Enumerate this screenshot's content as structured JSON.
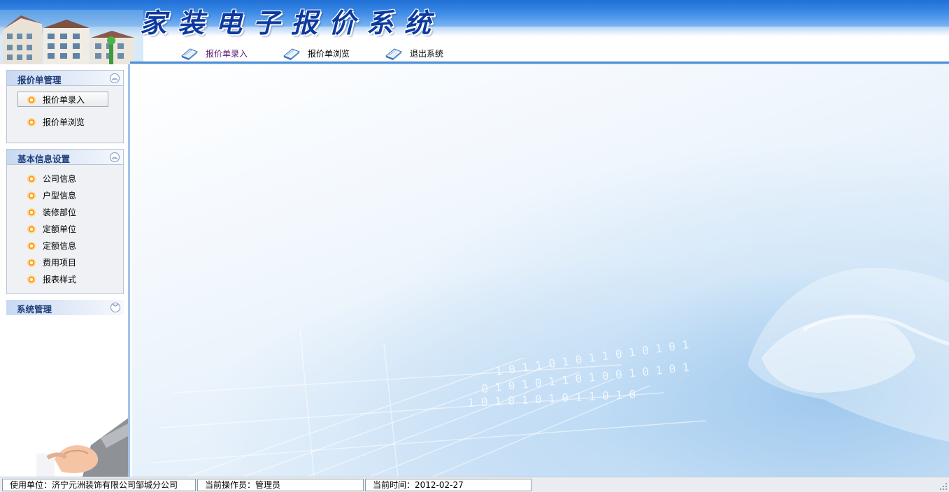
{
  "header": {
    "title": "家装电子报价系统",
    "nav": [
      {
        "label": "报价单录入",
        "icon": "book-icon"
      },
      {
        "label": "报价单浏览",
        "icon": "book-icon"
      },
      {
        "label": "退出系统",
        "icon": "book-icon"
      }
    ]
  },
  "sidebar": {
    "panels": [
      {
        "title": "报价单管理",
        "toggle": "︽",
        "items": [
          "报价单录入",
          "报价单浏览"
        ]
      },
      {
        "title": "基本信息设置",
        "toggle": "︽",
        "items": [
          "公司信息",
          "户型信息",
          "装修部位",
          "定额单位",
          "定额信息",
          "费用项目",
          "报表样式"
        ]
      },
      {
        "title": "系统管理",
        "toggle": "︾"
      }
    ]
  },
  "statusbar": {
    "company": "使用单位：济宁元洲装饰有限公司邹城分公司",
    "operator": "当前操作员：管理员",
    "time": "当前时间：2012-02-27"
  },
  "colors": {
    "header_blue": "#1f6fd6",
    "title_blue": "#0c3aa0",
    "panel_title": "#1f3f7a",
    "bullet_orange": "#ff9a1a"
  }
}
